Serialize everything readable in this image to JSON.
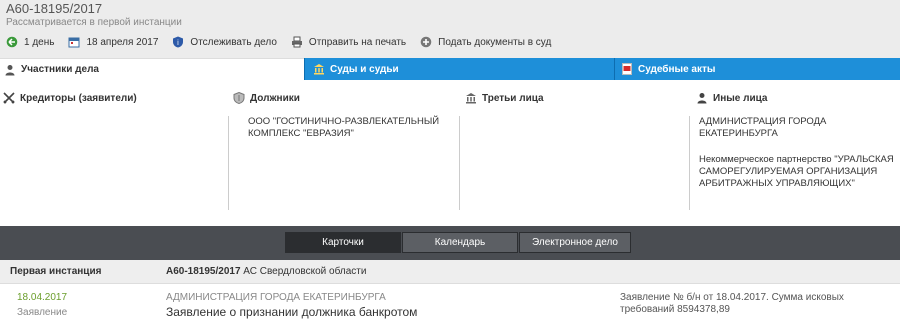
{
  "header": {
    "case_number": "А60-18195/2017",
    "status": "Рассматривается в первой инстанции",
    "actions": [
      {
        "icon": "back-arrow-icon",
        "label": "1 день"
      },
      {
        "icon": "calendar-icon",
        "label": "18 апреля 2017"
      },
      {
        "icon": "shield-icon",
        "label": "Отслеживать дело"
      },
      {
        "icon": "printer-icon",
        "label": "Отправить на печать"
      },
      {
        "icon": "plus-icon",
        "label": "Подать документы в суд"
      }
    ]
  },
  "tabs": {
    "participants": "Участники дела",
    "courts": "Суды и судьи",
    "acts": "Судебные акты"
  },
  "participants": {
    "creditors": {
      "title": "Кредиторы (заявители)",
      "entities": []
    },
    "debtors": {
      "title": "Должники",
      "entities": [
        "ООО \"ГОСТИНИЧНО-РАЗВЛЕКАТЕЛЬНЫЙ КОМПЛЕКС \"ЕВРАЗИЯ\""
      ]
    },
    "third_parties": {
      "title": "Третьи лица",
      "entities": []
    },
    "others": {
      "title": "Иные лица",
      "entity1": "АДМИНИСТРАЦИЯ ГОРОДА ЕКАТЕРИНБУРГА",
      "entity2": "Некоммерческое партнерство \"УРАЛЬСКАЯ САМОРЕГУЛИРУЕМАЯ ОРГАНИЗАЦИЯ АРБИТРАЖНЫХ УПРАВЛЯЮЩИХ\""
    }
  },
  "toolbar": {
    "cards": "Карточки",
    "calendar": "Календарь",
    "edoc": "Электронное дело"
  },
  "instance": {
    "title": "Первая инстанция",
    "case_number": "А60-18195/2017",
    "court": "АС Свердловской области"
  },
  "document": {
    "date": "18.04.2017",
    "type": "Заявление",
    "organization": "АДМИНИСТРАЦИЯ ГОРОДА ЕКАТЕРИНБУРГА",
    "title": "Заявление о признании должника банкротом",
    "note": "Заявление № б/н от 18.04.2017. Сумма исковых требований 8594378,89"
  },
  "colors": {
    "tab_blue": "#1e8fd9",
    "toolbar_dark": "#4a4d52",
    "date_green": "#6b9e2c"
  }
}
